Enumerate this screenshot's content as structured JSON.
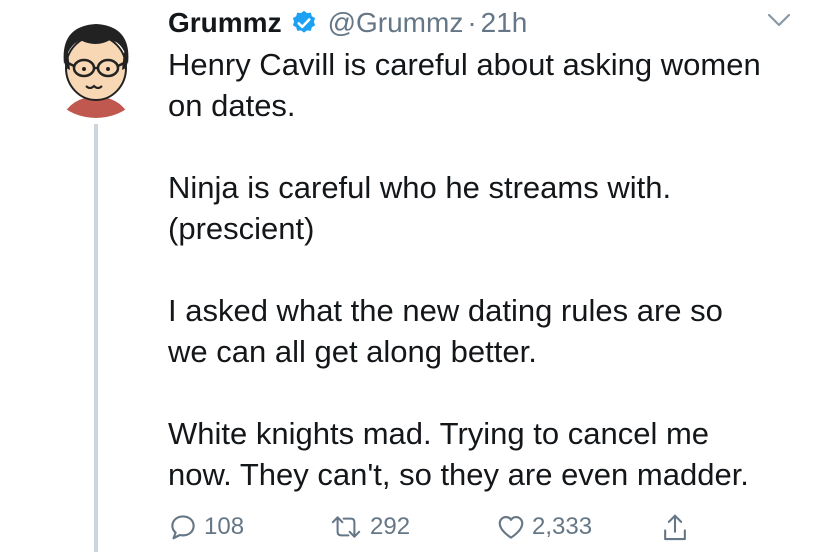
{
  "tweet": {
    "author_name": "Grummz",
    "handle": "@Grummz",
    "separator": "·",
    "time": "21h",
    "verified": true,
    "lines": [
      "Henry Cavill is careful about asking women",
      "on dates.",
      "",
      "Ninja is careful who he streams with.",
      "(prescient)",
      "",
      "I asked what the new dating rules are so",
      "we can all get along better.",
      "",
      "White knights mad. Trying to cancel me",
      "now. They can't, so they are even madder."
    ]
  },
  "actions": {
    "reply_count": "108",
    "retweet_count": "292",
    "like_count": "2,333"
  },
  "icons": {
    "reply": "reply-icon",
    "retweet": "retweet-icon",
    "like": "heart-icon",
    "share": "share-icon",
    "menu": "chevron-down-icon",
    "verified": "verified-badge-icon"
  },
  "colors": {
    "text": "#14171a",
    "secondary": "#657786",
    "verified": "#1da1f2",
    "thread_line": "#ccd6dd"
  }
}
